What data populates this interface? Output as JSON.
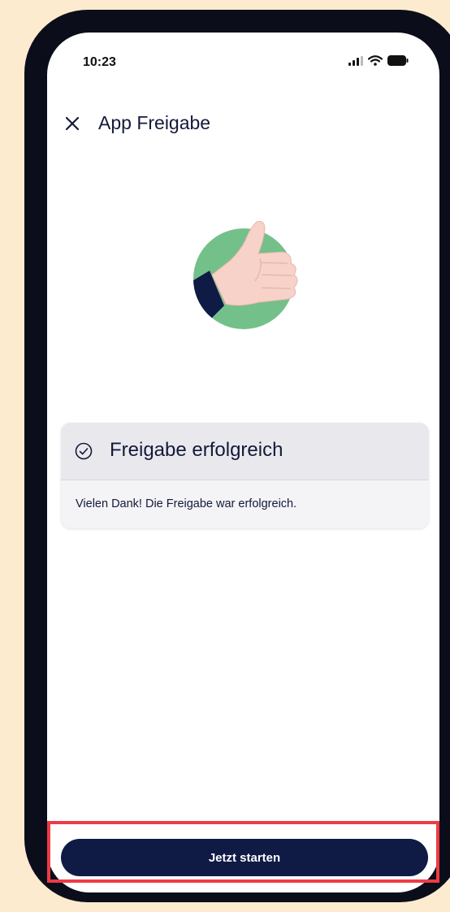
{
  "status_bar": {
    "time": "10:23",
    "icons": [
      "signal-icon",
      "wifi-icon",
      "battery-icon"
    ]
  },
  "header": {
    "close_icon": "close-icon",
    "title": "App Freigabe"
  },
  "illustration": {
    "name": "thumbs-up-illustration",
    "colors": {
      "circle": "#74c08a",
      "hand": "#f7d2c9",
      "sleeve": "#0f1a45"
    }
  },
  "success_card": {
    "icon": "check-circle-icon",
    "title": "Freigabe erfolgreich",
    "message": "Vielen Dank! Die Freigabe war erfolgreich."
  },
  "footer": {
    "button_label": "Jetzt starten"
  },
  "colors": {
    "background": "#fcebcf",
    "phone_frame": "#0b0e1a",
    "primary": "#0f1a45",
    "highlight": "#ee3b45"
  }
}
